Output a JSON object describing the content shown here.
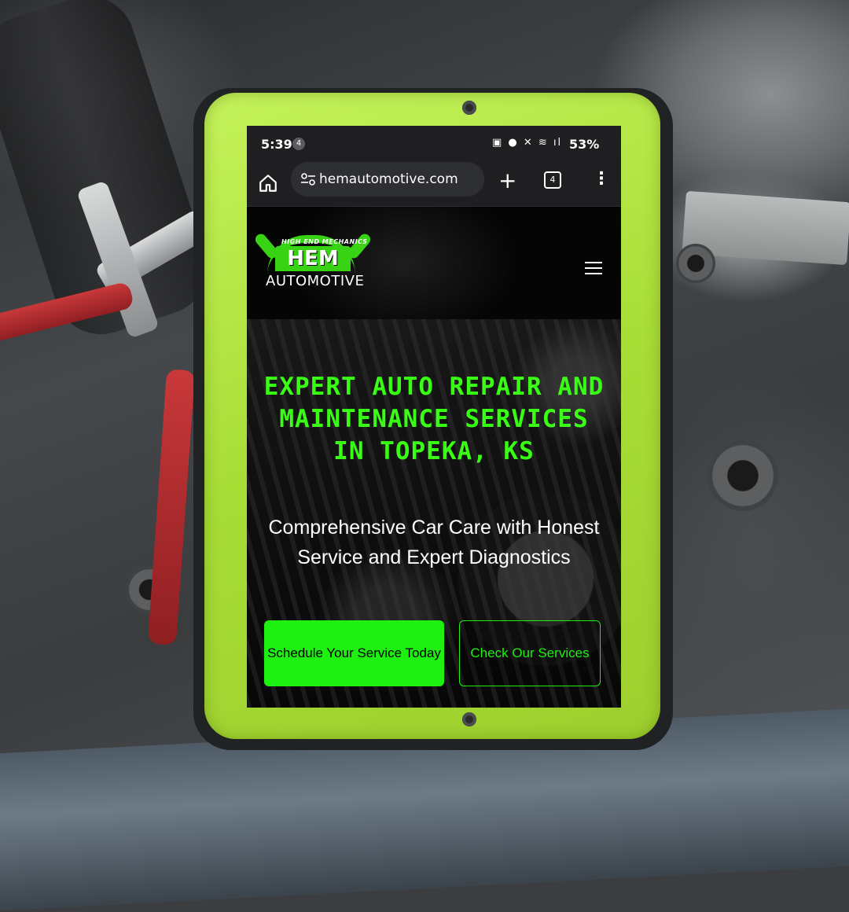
{
  "status_bar": {
    "time": "5:39",
    "notification_count": "4",
    "icons": "▣ ● ✕ ≋ ıl",
    "battery": "53%"
  },
  "browser": {
    "url": "hemautomotive.com",
    "tab_count": "4",
    "new_tab_glyph": "+",
    "menu_glyph": "⋮"
  },
  "site": {
    "logo": {
      "arc_text": "HIGH END MECHANICS",
      "brand": "HEM",
      "sub_brand": "AUTOMOTIVE"
    },
    "hero": {
      "title": "Expert Auto Repair and Maintenance Services in Topeka, KS",
      "subtitle": "Comprehensive Car Care with Honest Service and Expert Diagnostics",
      "primary_button": "Schedule Your Service Today",
      "secondary_button": "Check Our Services"
    }
  },
  "colors": {
    "accent_green": "#1ef012",
    "case_green": "#b4e645",
    "browser_chrome": "#1f1f22"
  },
  "icons": [
    "home-icon",
    "tune-icon",
    "plus-icon",
    "tabs-icon",
    "overflow-menu-icon",
    "hamburger-icon"
  ]
}
